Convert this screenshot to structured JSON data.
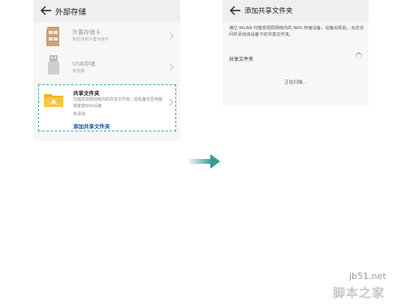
{
  "left_screen": {
    "title": "外部存储",
    "sd_card": {
      "title": "外置存储卡",
      "subtitle": "未检测到外置存储卡"
    },
    "usb": {
      "title": "USB存储",
      "subtitle": "未连接"
    },
    "shared_folder": {
      "title": "共享文件夹",
      "description": "扫描发现局网络内的共享文件夹，轻松备份至电脑或家庭NAS设备",
      "status": "未添加",
      "action": "添加共享文件夹"
    }
  },
  "right_screen": {
    "title": "添加共享文件夹",
    "description": "通过 WLAN 扫描发现局网络内的 NAS 存储设备，设备出现后，点击访问并添加该设备下的共享文件夹。",
    "section_label": "共享文件夹",
    "scanning_text": "正在扫描..."
  },
  "watermark": {
    "url": "jb51.net",
    "text": "脚本之家"
  },
  "colors": {
    "accent": "#4aa9a2",
    "link": "#1f4fa8",
    "sd_card_icon": "#c9a27a"
  },
  "icons": {
    "back": "arrow-left-icon",
    "sd_card": "sd-card-icon",
    "usb": "usb-drive-icon",
    "folder": "shared-folder-icon",
    "chevron": "chevron-right-icon",
    "spinner": "loading-spinner-icon",
    "transition": "right-arrow-icon"
  }
}
